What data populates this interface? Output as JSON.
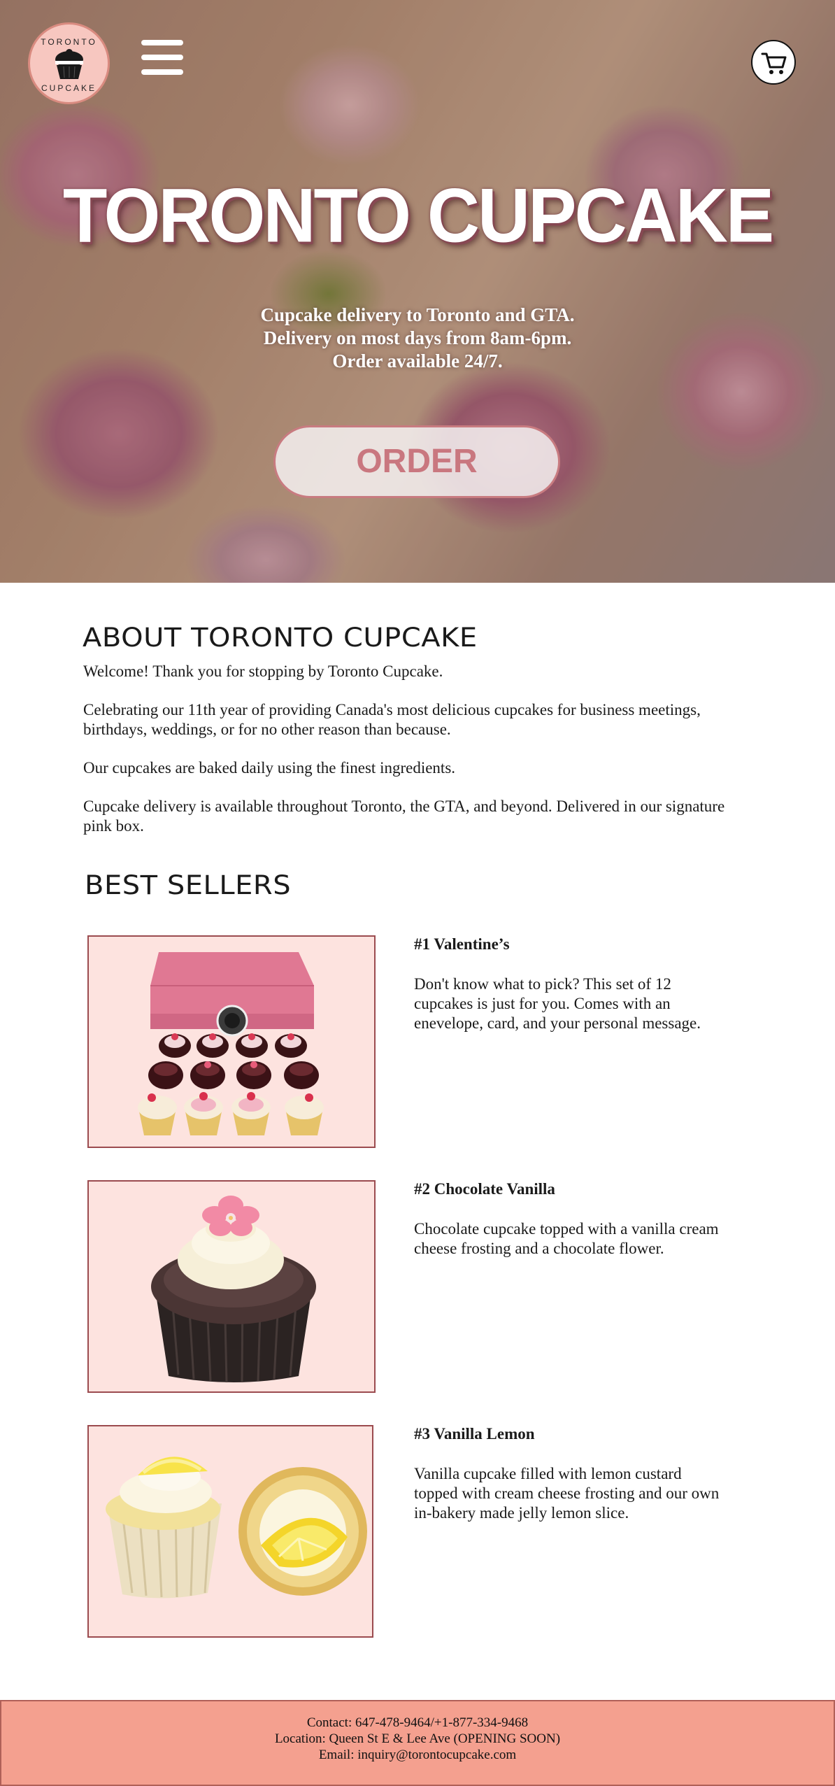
{
  "header": {
    "logo": {
      "top_text": "TORONTO",
      "bottom_text": "CUPCAKE",
      "icon": "cupcake-logo-icon"
    },
    "menu_icon": "hamburger-menu-icon",
    "cart_icon": "shopping-cart-icon"
  },
  "hero": {
    "title": "TORONTO CUPCAKE",
    "tagline_line1": "Cupcake delivery to Toronto and GTA.",
    "tagline_line2": "Delivery on most days from 8am-6pm.",
    "tagline_line3": "Order available 24/7.",
    "order_label": "ORDER"
  },
  "about": {
    "heading": "ABOUT TORONTO CUPCAKE",
    "paragraphs": [
      "Welcome! Thank you for stopping by Toronto Cupcake.",
      "Celebrating our 11th year of providing Canada's most delicious cupcakes for business meetings, birthdays, weddings, or for no other reason than because.",
      "Our cupcakes are baked daily using the finest ingredients.",
      "Cupcake delivery is available throughout Toronto, the GTA, and beyond. Delivered in our signature pink box."
    ]
  },
  "best_sellers": {
    "heading": "BEST SELLERS",
    "items": [
      {
        "name": "#1 Valentine’s",
        "description": "Don't know what to pick? This set of 12 cupcakes is just for you. Comes with an enevelope, card, and your personal message."
      },
      {
        "name": "#2 Chocolate Vanilla",
        "description": "Chocolate cupcake topped with a vanilla cream cheese frosting and a chocolate flower."
      },
      {
        "name": "#3 Vanilla Lemon",
        "description": "Vanilla cupcake filled with lemon custard topped with cream cheese frosting and our own in-bakery made jelly lemon slice."
      }
    ]
  },
  "footer": {
    "contact": "Contact: 647-478-9464/+1-877-334-9468",
    "location": "Location: Queen St E & Lee Ave (OPENING SOON)",
    "email": "Email: inquiry@torontocupcake.com"
  },
  "colors": {
    "footer_bg": "#f4a08f",
    "product_bg": "#fde3df",
    "order_text": "#c9777f"
  }
}
